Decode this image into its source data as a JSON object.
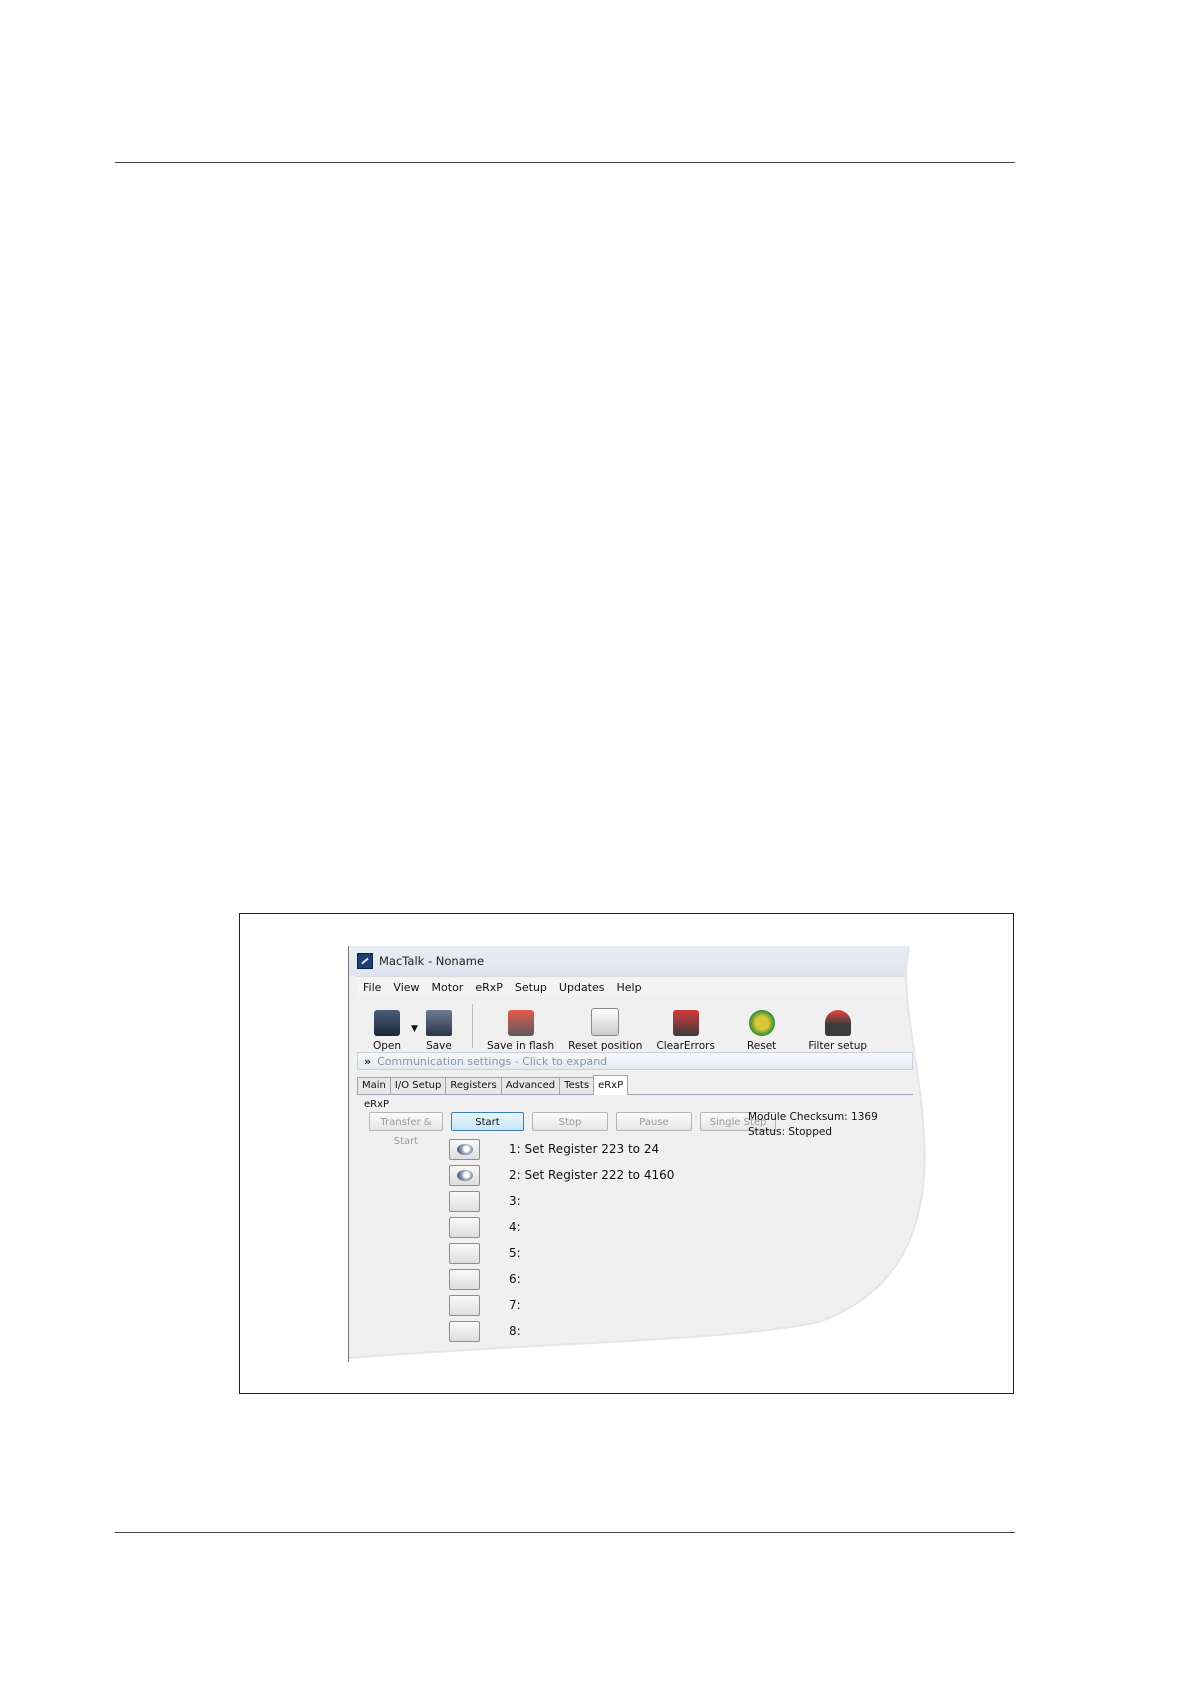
{
  "app": {
    "title": "MacTalk - Noname"
  },
  "menu": [
    "File",
    "View",
    "Motor",
    "eRxP",
    "Setup",
    "Updates",
    "Help"
  ],
  "toolbar": {
    "open_label": "Open",
    "save_label": "Save",
    "save_in_flash_label": "Save in flash",
    "reset_position_label": "Reset position",
    "clear_errors_label": "ClearErrors",
    "reset_label": "Reset",
    "filter_setup_label": "Filter setup"
  },
  "communication": {
    "label": "Communication settings - Click to expand"
  },
  "tabs": [
    "Main",
    "I/O Setup",
    "Registers",
    "Advanced",
    "Tests",
    "eRxP"
  ],
  "panel": {
    "label": "eRxP",
    "buttons": {
      "transfer_start": "Transfer & Start",
      "start": "Start",
      "stop": "Stop",
      "pause": "Pause",
      "single_step": "Single Step"
    },
    "module_checksum": "Module Checksum: 1369",
    "status": "Status: Stopped"
  },
  "steps": [
    {
      "text": "1: Set Register 223 to 24"
    },
    {
      "text": "2: Set Register 222 to 4160"
    },
    {
      "text": "3:"
    },
    {
      "text": "4:"
    },
    {
      "text": "5:"
    },
    {
      "text": "6:"
    },
    {
      "text": "7:"
    },
    {
      "text": "8:"
    }
  ]
}
